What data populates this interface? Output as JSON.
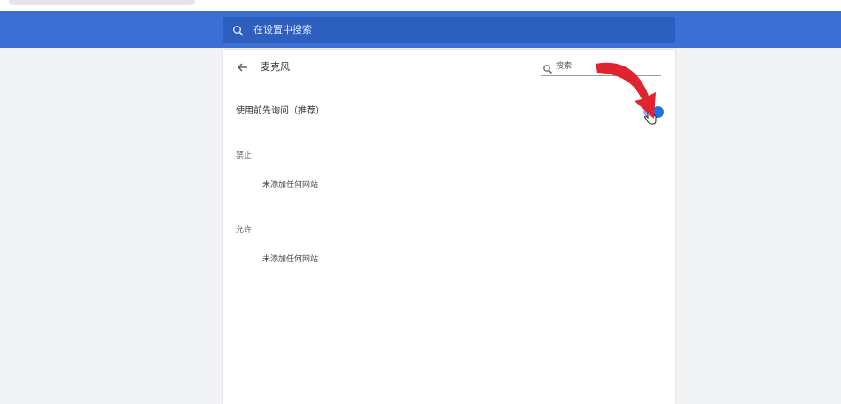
{
  "header": {
    "search_placeholder": "在设置中搜索"
  },
  "page": {
    "title": "麦克风",
    "search_label": "搜索",
    "ask_before_access_label": "使用前先询问（推荐）",
    "ask_before_access_enabled": true
  },
  "sections": [
    {
      "label": "禁止",
      "empty_text": "未添加任何网站"
    },
    {
      "label": "允许",
      "empty_text": "未添加任何网站"
    }
  ],
  "colors": {
    "header_bg": "#3c6fd6",
    "toggle_on": "#1a73e8",
    "annotation_arrow": "#e0242f"
  }
}
